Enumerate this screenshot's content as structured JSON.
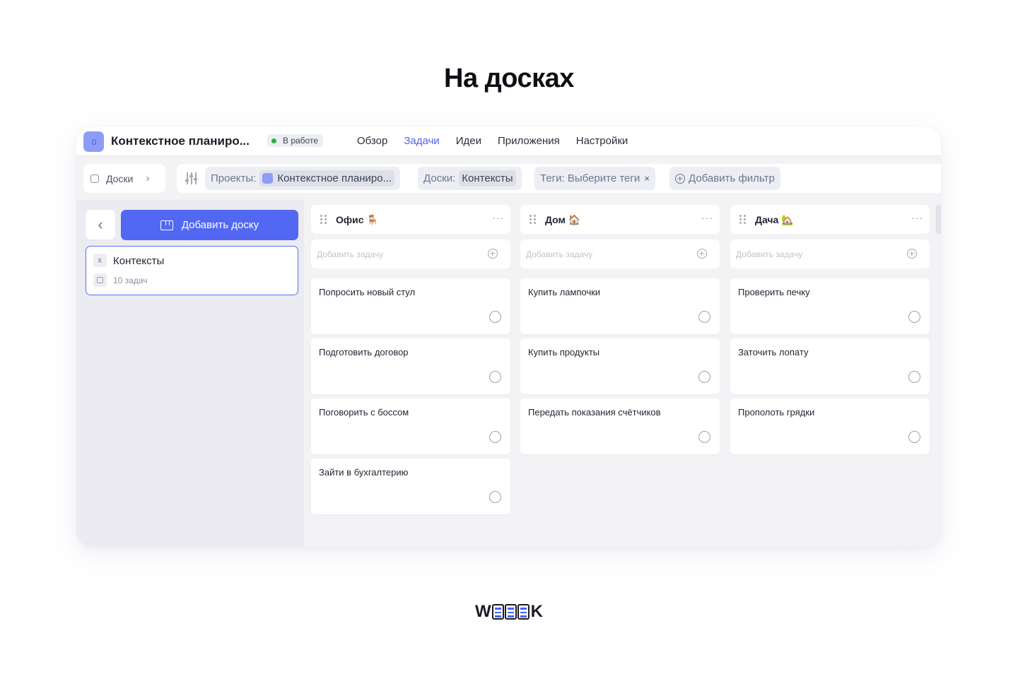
{
  "hero": {
    "title": "На досках"
  },
  "project": {
    "title": "Контекстное планиро...",
    "status": "В работе"
  },
  "nav": [
    {
      "label": "Обзор",
      "active": false
    },
    {
      "label": "Задачи",
      "active": true
    },
    {
      "label": "Идеи",
      "active": false
    },
    {
      "label": "Приложения",
      "active": false
    },
    {
      "label": "Настройки",
      "active": false
    }
  ],
  "boards_toggle": {
    "label": "Доски"
  },
  "filters": {
    "projects_label": "Проекты:",
    "projects_value": "Контекстное планиро...",
    "boards_label": "Доски:",
    "boards_value": "Контексты",
    "tags_label": "Теги: Выберите теги",
    "tags_clear": "×",
    "add_filter": "Добавить фильтр"
  },
  "sidebar": {
    "add_board": "Добавить доску",
    "board": {
      "initial": "К",
      "name": "Контексты",
      "count": "10 задач"
    }
  },
  "columns": [
    {
      "title": "Офис 🪑",
      "more": "···",
      "add_placeholder": "Добавить задачу",
      "tasks": [
        "Попросить новый стул",
        "Подготовить договор",
        "Поговорить с боссом",
        "Зайти в бухгалтерию"
      ]
    },
    {
      "title": "Дом 🏠",
      "more": "···",
      "add_placeholder": "Добавить задачу",
      "tasks": [
        "Купить лампочки",
        "Купить продукты",
        "Передать показания счётчиков"
      ]
    },
    {
      "title": "Дача 🏡",
      "more": "···",
      "add_placeholder": "Добавить задачу",
      "tasks": [
        "Проверить печку",
        "Заточить лопату",
        "Прополоть грядки"
      ]
    }
  ],
  "logo": {
    "left": "W",
    "right": "K"
  },
  "colors": {
    "accent": "#5268f2",
    "status_dot": "#27ae4f",
    "project_icon": "#8d9df6"
  }
}
